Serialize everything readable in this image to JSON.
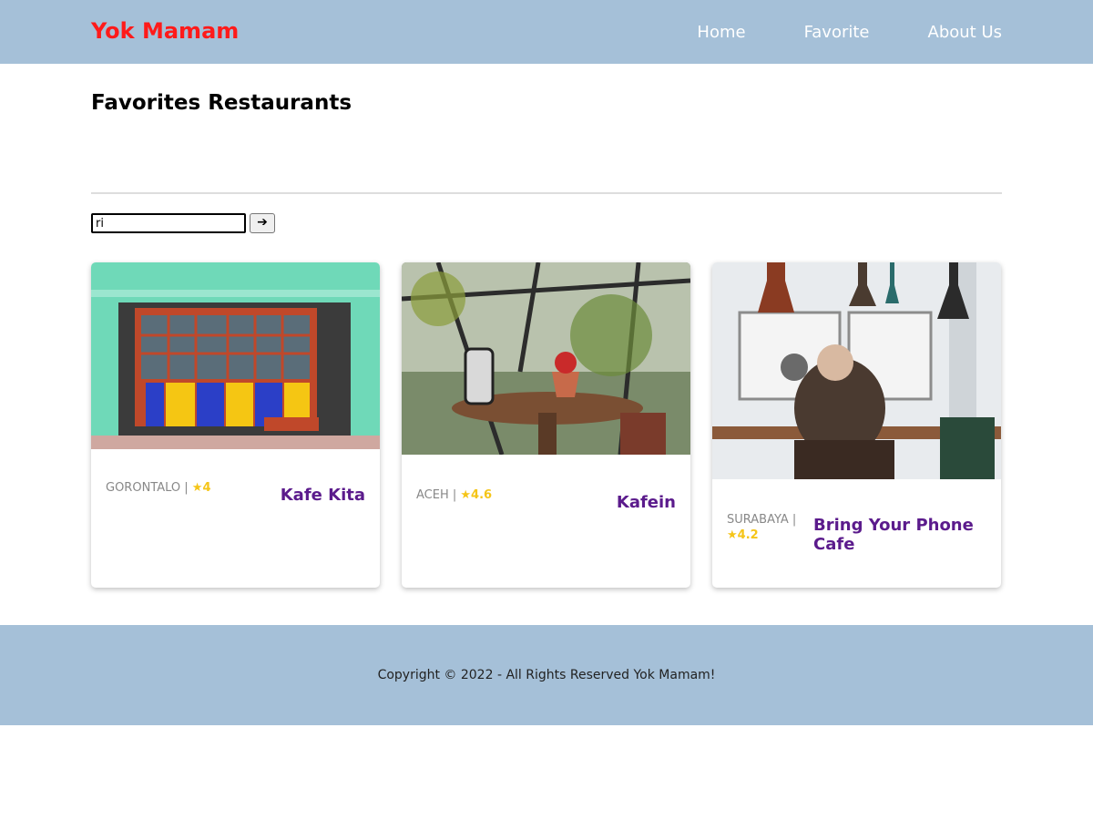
{
  "header": {
    "brand": "Yok Mamam",
    "nav": [
      "Home",
      "Favorite",
      "About Us"
    ]
  },
  "page": {
    "title": "Favorites Restaurants",
    "search_value": "ri",
    "search_button": "➔"
  },
  "restaurants": [
    {
      "city": "GORONTALO",
      "rating": "4",
      "name": "Kafe Kita"
    },
    {
      "city": "ACEH",
      "rating": "4.6",
      "name": "Kafein"
    },
    {
      "city": "SURABAYA",
      "rating": "4.2",
      "name": "Bring Your Phone Cafe"
    }
  ],
  "footer": {
    "copyright": "Copyright © 2022 - All Rights Reserved Yok Mamam!"
  },
  "colors": {
    "header_bg": "#a5c0d8",
    "brand": "#ff1a1a",
    "restaurant_name": "#5b1b8c",
    "rating_star": "#f5c518"
  }
}
